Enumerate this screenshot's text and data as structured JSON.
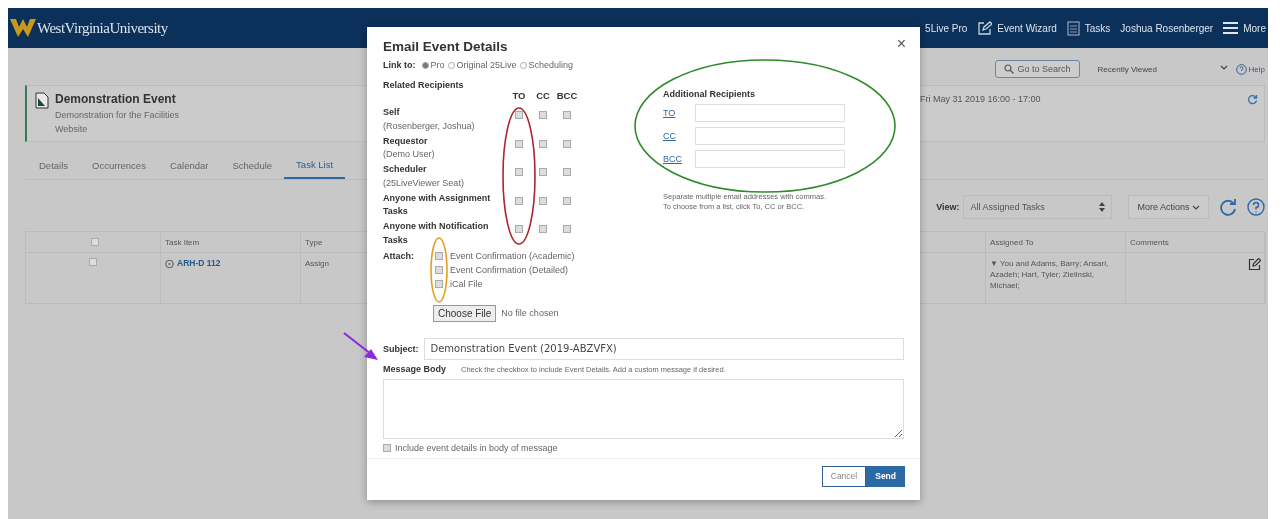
{
  "nav": {
    "logo": "WestVirginiaUniversity",
    "items": [
      {
        "kind": "pro",
        "label": "5Live Pro"
      },
      {
        "kind": "wizard",
        "label": "Event Wizard"
      },
      {
        "kind": "tasks",
        "label": "Tasks"
      },
      {
        "kind": "user",
        "label": "Joshua Rosenberger"
      },
      {
        "kind": "menu",
        "label": "More"
      }
    ]
  },
  "top_controls": {
    "search_button": "Go to Search",
    "recent": "Recently Viewed",
    "help": "Help"
  },
  "event": {
    "title": "Demonstration Event",
    "description": "Demonstration for the Facilities Website",
    "date": "Fri May 31 2019 16:00 - 17:00"
  },
  "tabs": [
    {
      "label": "Details",
      "selected": false
    },
    {
      "label": "Occurrences",
      "selected": false
    },
    {
      "label": "Calendar",
      "selected": false
    },
    {
      "label": "Schedule",
      "selected": false
    },
    {
      "label": "Task List",
      "selected": true
    }
  ],
  "toolbar": {
    "view_label": "View:",
    "view_value": "All Assigned Tasks",
    "more_actions": "More Actions"
  },
  "table": {
    "columns": [
      {
        "kind": "check",
        "checked": false
      },
      {
        "kind": "text",
        "label": "Task Item"
      },
      {
        "kind": "text",
        "label": "Type"
      },
      {
        "kind": "text",
        "label": "Assigned To"
      },
      {
        "kind": "text",
        "label": "Comments"
      }
    ],
    "rows": [
      {
        "checked": false,
        "task_item": "ARH-D 112",
        "type": "Assign",
        "assigned_to": "▼ You and Adams, Barry; Ansari, Azadeh; Hart, Tyler; Zielinski, Michael;"
      }
    ]
  },
  "dialog": {
    "title": "Email Event Details",
    "close": "×",
    "link_label": "Link to:",
    "link_options": [
      {
        "label": "Pro",
        "selected": true
      },
      {
        "label": "Original 25Live",
        "selected": false
      },
      {
        "label": "Scheduling",
        "selected": false
      }
    ],
    "related_title": "Related Recipients",
    "recipient_columns": [
      "TO",
      "CC",
      "BCC"
    ],
    "recipients": [
      {
        "name": "Self",
        "detail": "(Rosenberger, Joshua)",
        "to": false,
        "cc": false,
        "bcc": false
      },
      {
        "name": "Requestor",
        "detail": "(Demo User)",
        "to": false,
        "cc": false,
        "bcc": false
      },
      {
        "name": "Scheduler",
        "detail": "(25LiveViewer Seat)",
        "to": false,
        "cc": false,
        "bcc": false
      },
      {
        "name": "Anyone with Assignment Tasks",
        "to": false,
        "cc": false,
        "bcc": false
      },
      {
        "name": "Anyone with Notification Tasks",
        "to": false,
        "cc": false,
        "bcc": false
      }
    ],
    "attach_label": "Attach:",
    "attachments": [
      {
        "label": "Event Confirmation (Academic)",
        "checked": false
      },
      {
        "label": "Event Confirmation (Detailed)",
        "checked": false
      },
      {
        "label": "iCal File",
        "checked": false
      }
    ],
    "choose_file": "Choose File",
    "no_file": "No file chosen",
    "additional_title": "Additional Recipients",
    "additional": [
      {
        "label": "TO"
      },
      {
        "label": "CC"
      },
      {
        "label": "BCC"
      }
    ],
    "additional_hint": "Separate multiple email addresses with commas. To choose from a list, click To, CC or BCC.",
    "subject_label": "Subject:",
    "subject_value": "Demonstration Event (2019-ABZVFX)",
    "body_label": "Message Body",
    "body_hint": "Check the checkbox to include Event Details. Add a custom message if desired.",
    "include_details": {
      "label": "Include event details in body of message",
      "checked": false
    },
    "buttons": [
      {
        "kind": "cancel",
        "label": "Cancel"
      },
      {
        "kind": "send",
        "label": "Send"
      }
    ]
  }
}
